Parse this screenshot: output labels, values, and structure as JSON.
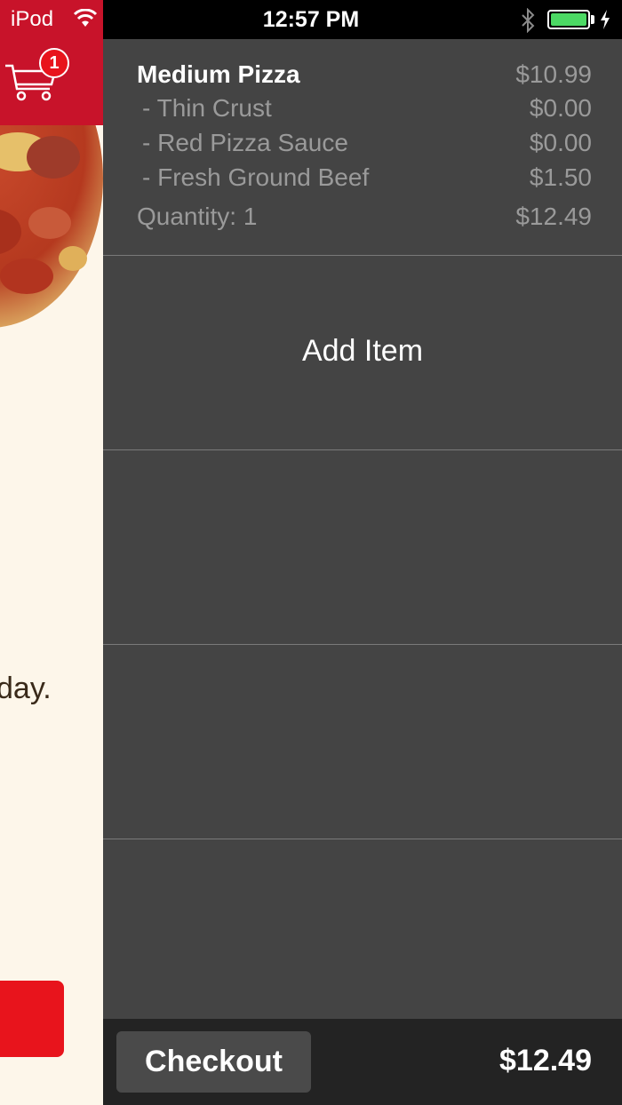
{
  "status_bar": {
    "carrier": "iPod",
    "time": "12:57 PM",
    "battery_level": 1.0,
    "battery_color": "#4cd964"
  },
  "left_panel": {
    "cart_badge_count": "1",
    "promo_text_fragment": "day."
  },
  "cart": {
    "item": {
      "name": "Medium Pizza",
      "price": "$10.99",
      "options": [
        {
          "label": "- Thin Crust",
          "price": "$0.00"
        },
        {
          "label": "- Red Pizza Sauce",
          "price": "$0.00"
        },
        {
          "label": "- Fresh Ground Beef",
          "price": "$1.50"
        }
      ],
      "quantity_label": "Quantity: 1",
      "line_total": "$12.49"
    },
    "add_item_label": "Add Item"
  },
  "bottom_bar": {
    "checkout_label": "Checkout",
    "total": "$12.49"
  },
  "colors": {
    "brand_red": "#c8132a",
    "panel_bg": "#444444",
    "bottom_bar_bg": "#232323"
  }
}
